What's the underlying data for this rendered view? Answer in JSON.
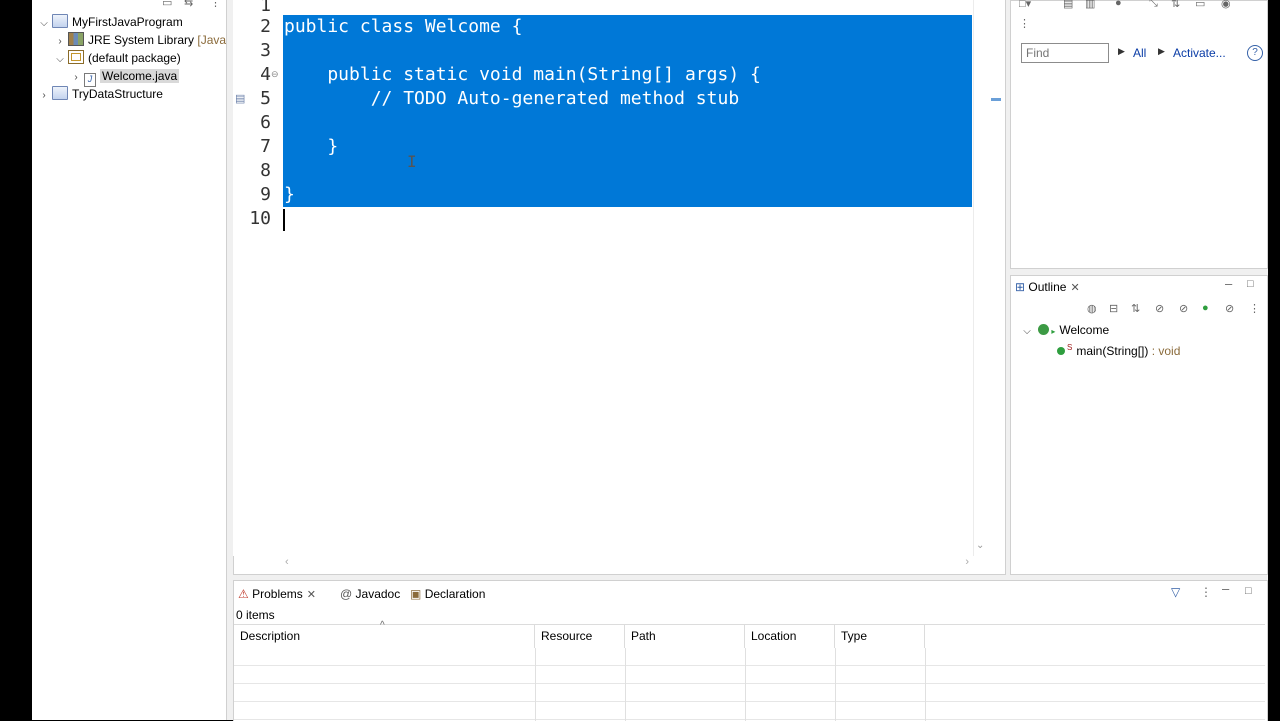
{
  "package_explorer": {
    "items": [
      {
        "label": "MyFirstJavaProgram",
        "decor": ""
      },
      {
        "label": "JRE System Library",
        "decor": "[JavaSE"
      },
      {
        "label": "(default package)",
        "decor": ""
      },
      {
        "label": "Welcome.java",
        "decor": ""
      },
      {
        "label": "TryDataStructure",
        "decor": ""
      }
    ]
  },
  "editor": {
    "line_numbers": [
      "1",
      "2",
      "3",
      "4",
      "5",
      "6",
      "7",
      "8",
      "9",
      "10"
    ],
    "lines": [
      "",
      "public class Welcome {",
      "",
      "    public static void main(String[] args) {",
      "        // TODO Auto-generated method stub",
      "",
      "    }",
      "",
      "}",
      ""
    ]
  },
  "right_top": {
    "find_placeholder": "Find",
    "all_label": "All",
    "activate_label": "Activate...",
    "help_label": "?"
  },
  "outline": {
    "tab_label": "Outline",
    "class_name": "Welcome",
    "method_name": "main(String[])",
    "method_type": " : void"
  },
  "problems": {
    "tabs": [
      "Problems",
      "Javadoc",
      "Declaration"
    ],
    "count": "0 items",
    "columns": [
      "Description",
      "Resource",
      "Path",
      "Location",
      "Type"
    ]
  },
  "colors": {
    "selection": "#0078d7",
    "background": "#f0f0f0"
  }
}
